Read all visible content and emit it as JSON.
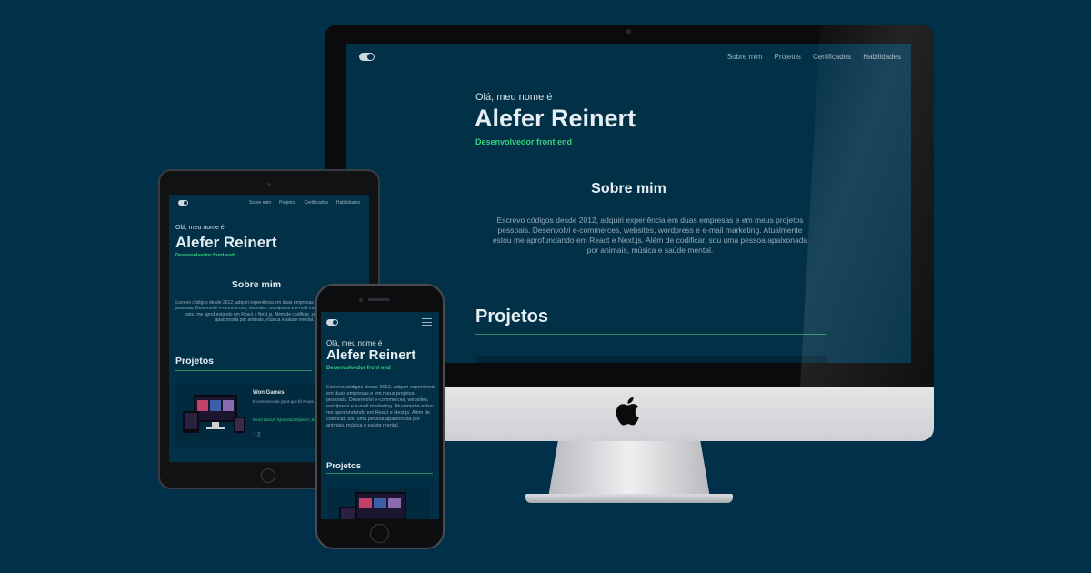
{
  "site": {
    "nav": [
      "Sobre mim",
      "Projetos",
      "Certificados",
      "Habilidades"
    ],
    "greeting": "Olá, meu nome é",
    "name": "Alefer Reinert",
    "role": "Desenvolvedor front end",
    "about_title": "Sobre mim",
    "about_text": "Escrevo códigos desde 2012, adquiri experiência em duas empresas e em meus projetos pessoais. Desenvolvi e-commerces, websites, wordpress e e-mail marketing. Atualmente estou me aprofundando em React e Next.js. Além de codificar, sou uma pessoa apaixonada por animais, música e saúde mental.",
    "projects_title": "Projetos"
  },
  "project_card": {
    "title": "Won Games",
    "description": "E-commerce de jogos que fiz React Avançado, um desenvolvi",
    "tags": "React NextJs TypeScript Styled-C Jest"
  },
  "colors": {
    "page_background": "#01304b",
    "site_background": "#023047",
    "accent": "#35d07f"
  },
  "icons": [
    "theme-toggle-icon",
    "hamburger-menu-icon",
    "apple-logo-icon",
    "github-icon",
    "link-icon"
  ]
}
